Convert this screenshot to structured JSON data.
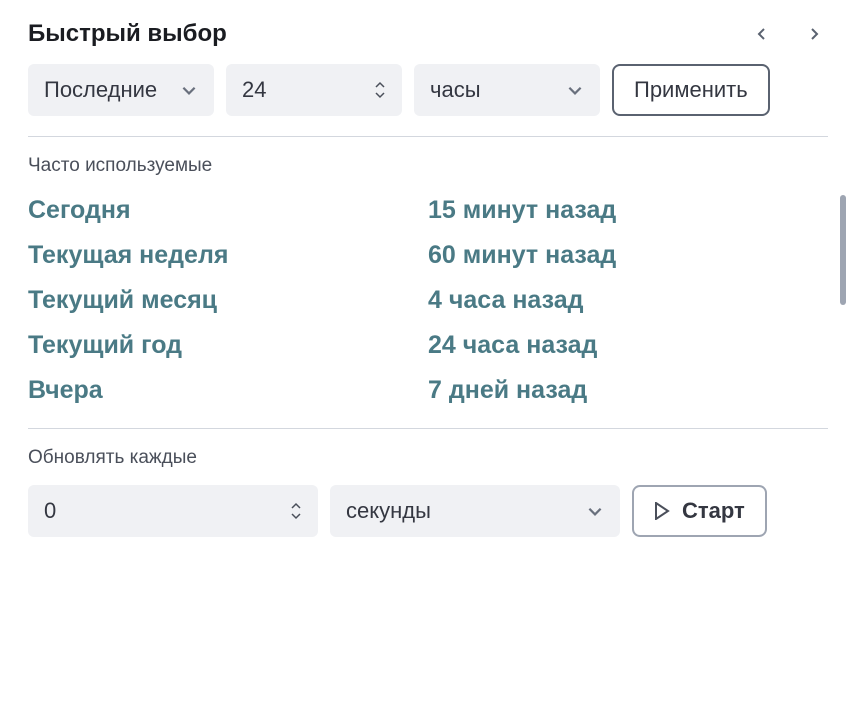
{
  "header": {
    "title": "Быстрый выбор"
  },
  "quickSelect": {
    "tense": "Последние",
    "value": "24",
    "unit": "часы",
    "applyLabel": "Применить"
  },
  "commonlyUsed": {
    "title": "Часто используемые",
    "col1": [
      "Сегодня",
      "Текущая неделя",
      "Текущий месяц",
      "Текущий год",
      "Вчера"
    ],
    "col2": [
      "15 минут назад",
      "60 минут назад",
      "4 часа назад",
      "24 часа назад",
      "7 дней назад"
    ]
  },
  "refresh": {
    "title": "Обновлять каждые",
    "value": "0",
    "unit": "секунды",
    "startLabel": "Старт"
  }
}
